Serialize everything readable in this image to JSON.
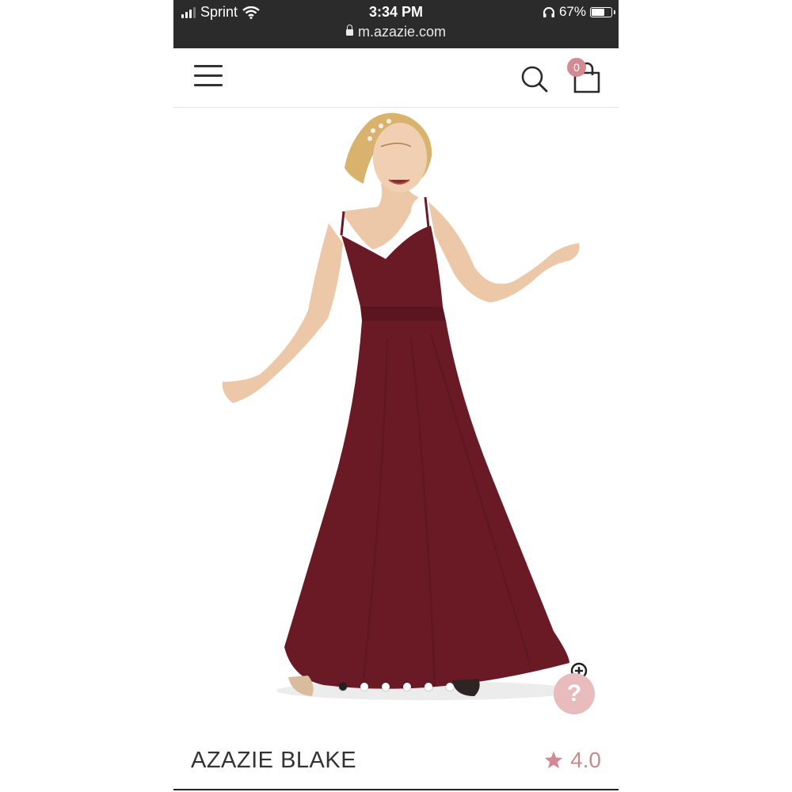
{
  "status_bar": {
    "carrier": "Sprint",
    "time": "3:34 PM",
    "battery_percent": "67%",
    "battery_level": 0.67,
    "url": "m.azazie.com"
  },
  "header": {
    "menu_icon": "hamburger-menu-icon",
    "search_icon": "search-icon",
    "cart_icon": "shopping-bag-icon",
    "cart_count": "0"
  },
  "gallery": {
    "image_count": 6,
    "active_index": 0,
    "dress_color": "#6a1a24",
    "help_label": "?"
  },
  "product": {
    "name": "AZAZIE BLAKE",
    "rating": "4.0",
    "rating_icon": "star-icon",
    "accent_color": "#d38a93"
  }
}
